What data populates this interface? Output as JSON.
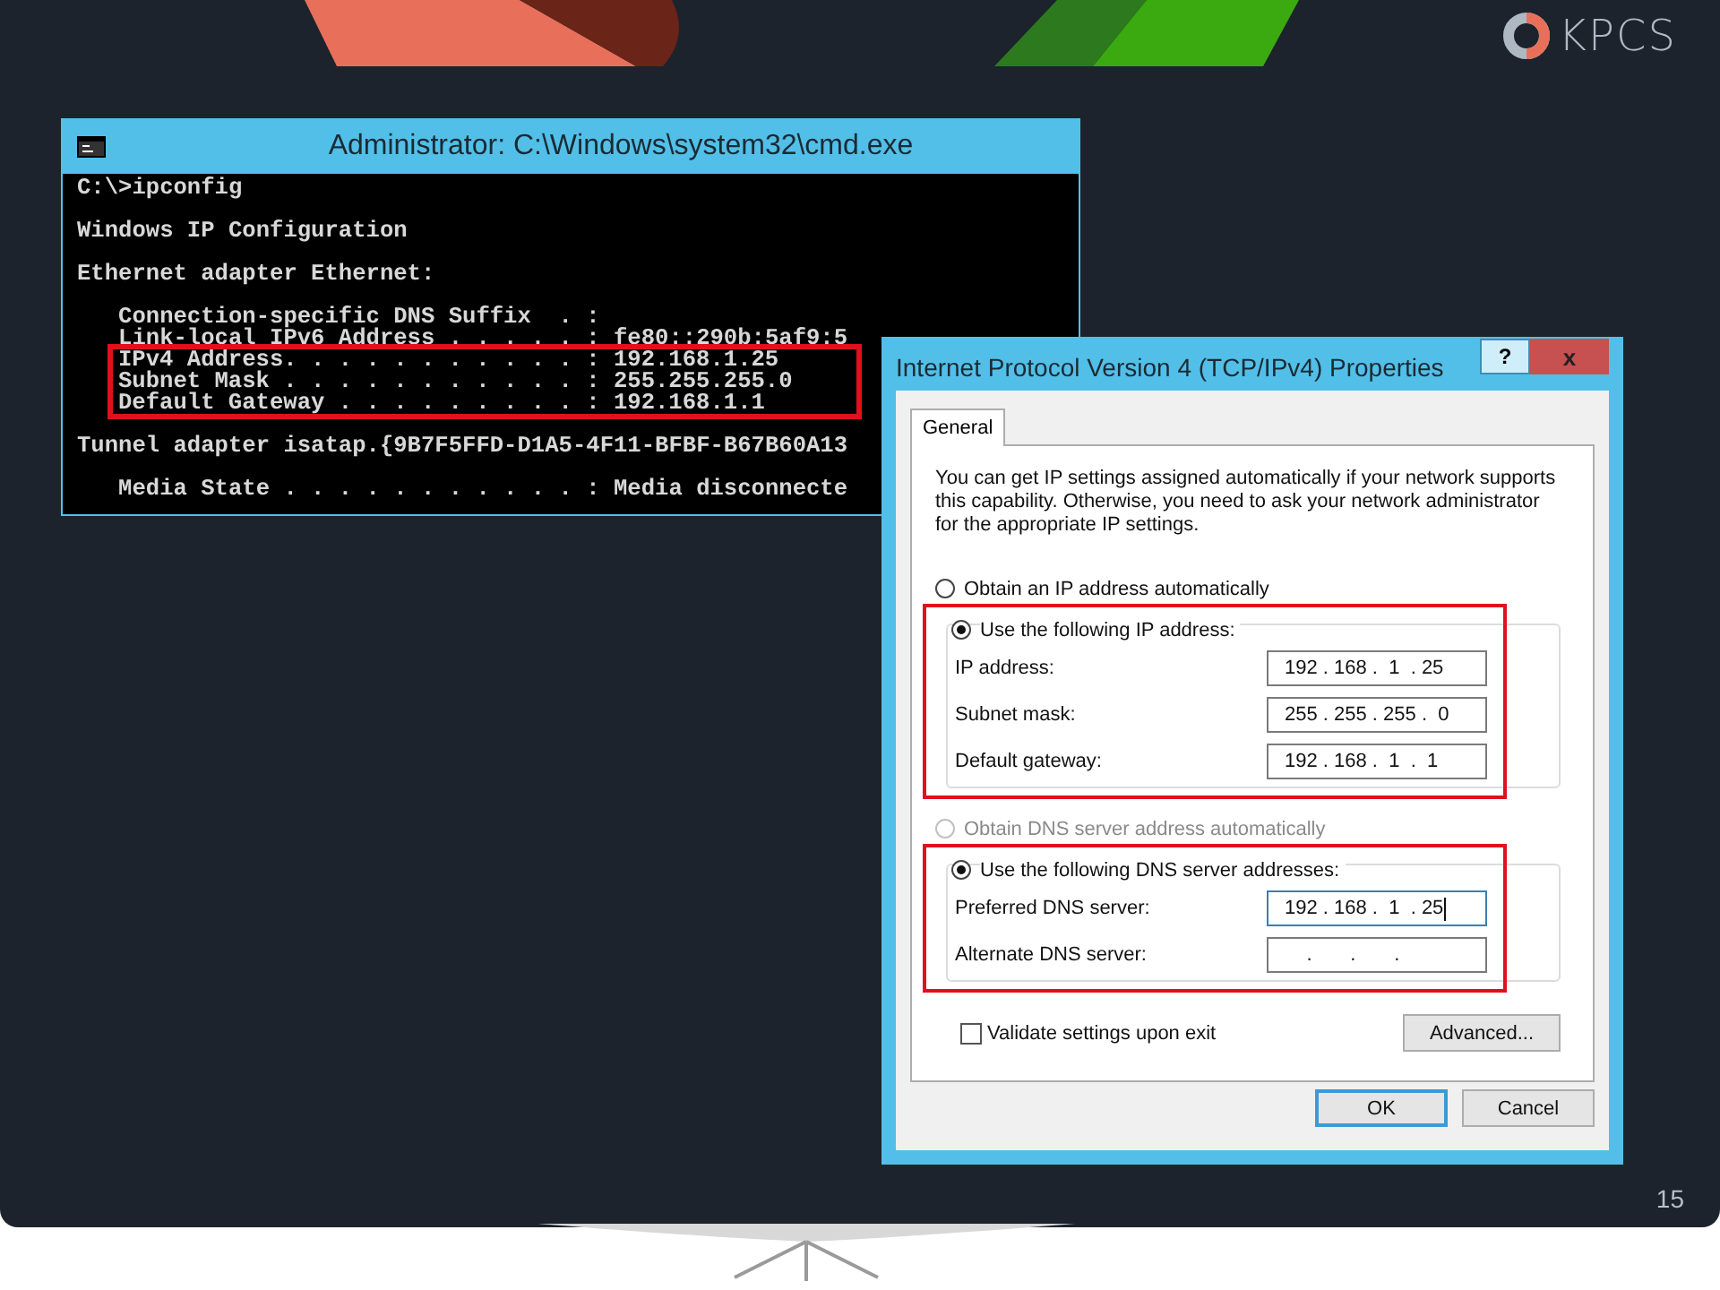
{
  "slide": {
    "page_number": "15",
    "logo": {
      "text": "KPCS"
    }
  },
  "cmd_window": {
    "title": "Administrator: C:\\Windows\\system32\\cmd.exe",
    "blocks": [
      {
        "spaced": false,
        "highlighted": false,
        "lines": [
          "C:\\>ipconfig"
        ]
      },
      {
        "spaced": true,
        "highlighted": false,
        "lines": [
          "Windows IP Configuration"
        ]
      },
      {
        "spaced": true,
        "highlighted": false,
        "lines": [
          "Ethernet adapter Ethernet:"
        ]
      },
      {
        "spaced": true,
        "highlighted": false,
        "lines": [
          "   Connection-specific DNS Suffix  . :",
          "   Link-local IPv6 Address . . . . . : fe80::290b:5af9:5"
        ]
      },
      {
        "spaced": false,
        "highlighted": true,
        "lines": [
          "IPv4 Address. . . . . . . . . . . : 192.168.1.25",
          "Subnet Mask . . . . . . . . . . . : 255.255.255.0",
          "Default Gateway . . . . . . . . . : 192.168.1.1"
        ]
      },
      {
        "spaced": true,
        "highlighted": false,
        "lines": [
          "Tunnel adapter isatap.{9B7F5FFD-D1A5-4F11-BFBF-B67B60A13"
        ]
      },
      {
        "spaced": true,
        "highlighted": false,
        "lines": [
          "   Media State . . . . . . . . . . . : Media disconnecte"
        ]
      }
    ]
  },
  "dialog": {
    "title": "Internet Protocol Version 4 (TCP/IPv4) Properties",
    "help_button": "?",
    "close_button": "x",
    "tabs": [
      {
        "label": "General",
        "selected": true
      }
    ],
    "intro": "You can get IP settings assigned automatically if your network supports this capability. Otherwise, you need to ask your network administrator for the appropriate IP settings.",
    "sections": [
      {
        "auto_option": {
          "label": "Obtain an IP address automatically",
          "selected": false,
          "disabled": false
        },
        "manual_option": {
          "label": "Use the following IP address:",
          "selected": true
        },
        "highlighted": true,
        "fields": [
          {
            "label": "IP address:",
            "value": "192 . 168 .  1  . 25",
            "focused": false
          },
          {
            "label": "Subnet mask:",
            "value": "255 . 255 . 255 .  0",
            "focused": false
          },
          {
            "label": "Default gateway:",
            "value": "192 . 168 .  1  .  1",
            "focused": false
          }
        ]
      },
      {
        "auto_option": {
          "label": "Obtain DNS server address automatically",
          "selected": false,
          "disabled": true
        },
        "manual_option": {
          "label": "Use the following DNS server addresses:",
          "selected": true
        },
        "highlighted": true,
        "fields": [
          {
            "label": "Preferred DNS server:",
            "value": "192 . 168 .  1  . 25",
            "focused": true
          },
          {
            "label": "Alternate DNS server:",
            "value": "    .       .       .    ",
            "focused": false
          }
        ]
      }
    ],
    "validate": {
      "label": "Validate settings upon exit",
      "checked": false
    },
    "advanced_button": "Advanced...",
    "buttons": [
      {
        "label": "OK",
        "default": true
      },
      {
        "label": "Cancel",
        "default": false
      }
    ]
  }
}
